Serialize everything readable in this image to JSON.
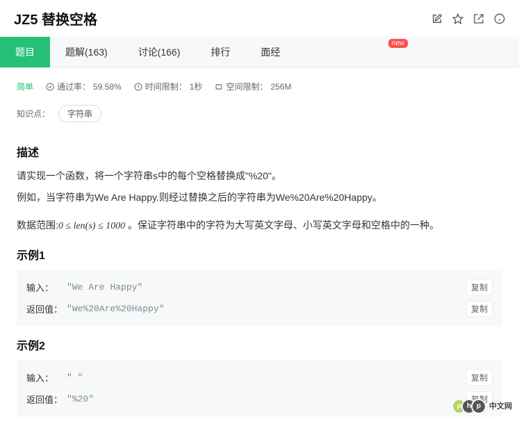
{
  "header": {
    "title": "JZ5 替换空格"
  },
  "tabs": {
    "problem": "题目",
    "solutions": "题解(163)",
    "discuss": "讨论(166)",
    "ranking": "排行",
    "interview": "面经",
    "badge": "new"
  },
  "meta": {
    "difficulty": "简单",
    "pass_label": "通过率：",
    "pass_value": "59.58%",
    "time_label": "时间限制：",
    "time_value": "1秒",
    "memory_label": "空间限制：",
    "memory_value": "256M"
  },
  "knowledge": {
    "label": "知识点：",
    "tag": "字符串"
  },
  "description": {
    "heading": "描述",
    "p1": "请实现一个函数，将一个字符串s中的每个空格替换成\"%20\"。",
    "p2": "例如，当字符串为We Are Happy.则经过替换之后的字符串为We%20Are%20Happy。",
    "range_prefix": "数据范围:",
    "range_math": "0 ≤ len(s) ≤ 1000",
    "range_suffix": " 。保证字符串中的字符为大写英文字母、小写英文字母和空格中的一种。"
  },
  "example1": {
    "heading": "示例1",
    "input_label": "输入：",
    "input_value": "\"We Are Happy\"",
    "return_label": "返回值：",
    "return_value": "\"We%20Are%20Happy\"",
    "copy": "复制"
  },
  "example2": {
    "heading": "示例2",
    "input_label": "输入：",
    "input_value": "\" \"",
    "return_label": "返回值：",
    "return_value": "\"%20\"",
    "copy": "复制"
  },
  "footer": {
    "php": "php",
    "cn": "中文网",
    "sub": " "
  }
}
